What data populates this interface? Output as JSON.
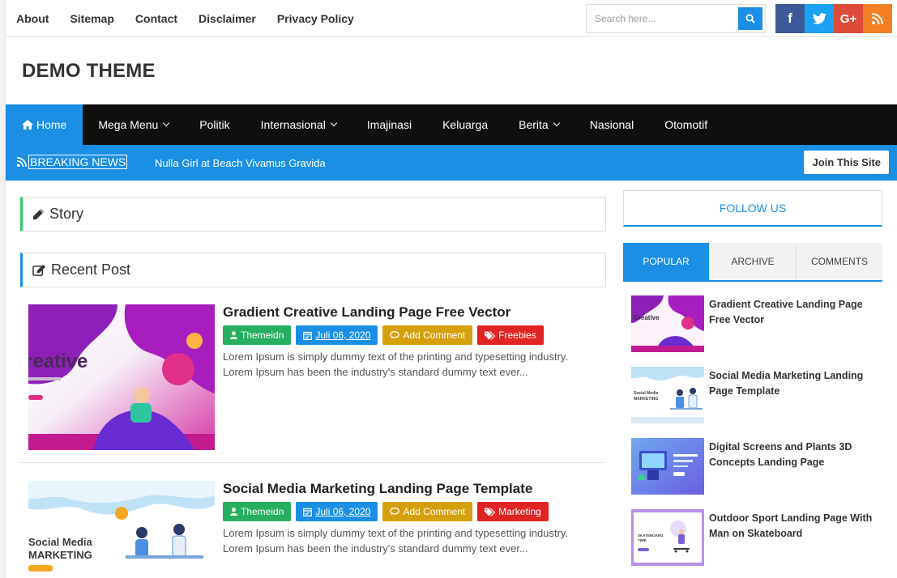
{
  "top_links": [
    "About",
    "Sitemap",
    "Contact",
    "Disclaimer",
    "Privacy Policy"
  ],
  "search": {
    "placeholder": "Search here..."
  },
  "social": [
    "facebook",
    "twitter",
    "google-plus",
    "rss"
  ],
  "site_title": "DEMO THEME",
  "nav": [
    {
      "label": "Home",
      "active": true,
      "icon": "home-icon"
    },
    {
      "label": "Mega Menu",
      "dropdown": true
    },
    {
      "label": "Politik"
    },
    {
      "label": "Internasional",
      "dropdown": true
    },
    {
      "label": "Imajinasi"
    },
    {
      "label": "Keluarga"
    },
    {
      "label": "Berita",
      "dropdown": true
    },
    {
      "label": "Nasional"
    },
    {
      "label": "Otomotif"
    }
  ],
  "breaking": {
    "label": "BREAKING NEWS",
    "item": "Nulla Girl at Beach Vivamus Gravida",
    "join_label": "Join This Site"
  },
  "sections": {
    "story": "Story",
    "recent": "Recent Post"
  },
  "posts": [
    {
      "title": "Gradient Creative Landing Page Free Vector",
      "author": "Themeidn",
      "date": "Juli 06, 2020",
      "comment": "Add Comment",
      "category": "Freebies",
      "excerpt": "Lorem Ipsum is simply dummy text of the printing and typesetting industry. Lorem Ipsum has been the industry's standard dummy text ever..."
    },
    {
      "title": "Social Media Marketing Landing Page Template",
      "author": "Themeidn",
      "date": "Juli 06, 2020",
      "comment": "Add Comment",
      "category": "Marketing",
      "excerpt": "Lorem Ipsum is simply dummy text of the printing and typesetting industry. Lorem Ipsum has been the industry's standard dummy text ever..."
    }
  ],
  "sidebar": {
    "follow_label": "FOLLOW US",
    "tabs": [
      "POPULAR",
      "ARCHIVE",
      "COMMENTS"
    ],
    "popular": [
      "Gradient Creative Landing Page Free Vector",
      "Social Media Marketing Landing Page Template",
      "Digital Screens and Plants 3D Concepts Landing Page",
      "Outdoor Sport Landing Page With Man on Skateboard"
    ]
  },
  "colors": {
    "accent": "#1a8fe3",
    "nav_bg": "#0f0f0f",
    "green": "#27ae60",
    "gold": "#d4a00e",
    "red": "#e02424"
  }
}
